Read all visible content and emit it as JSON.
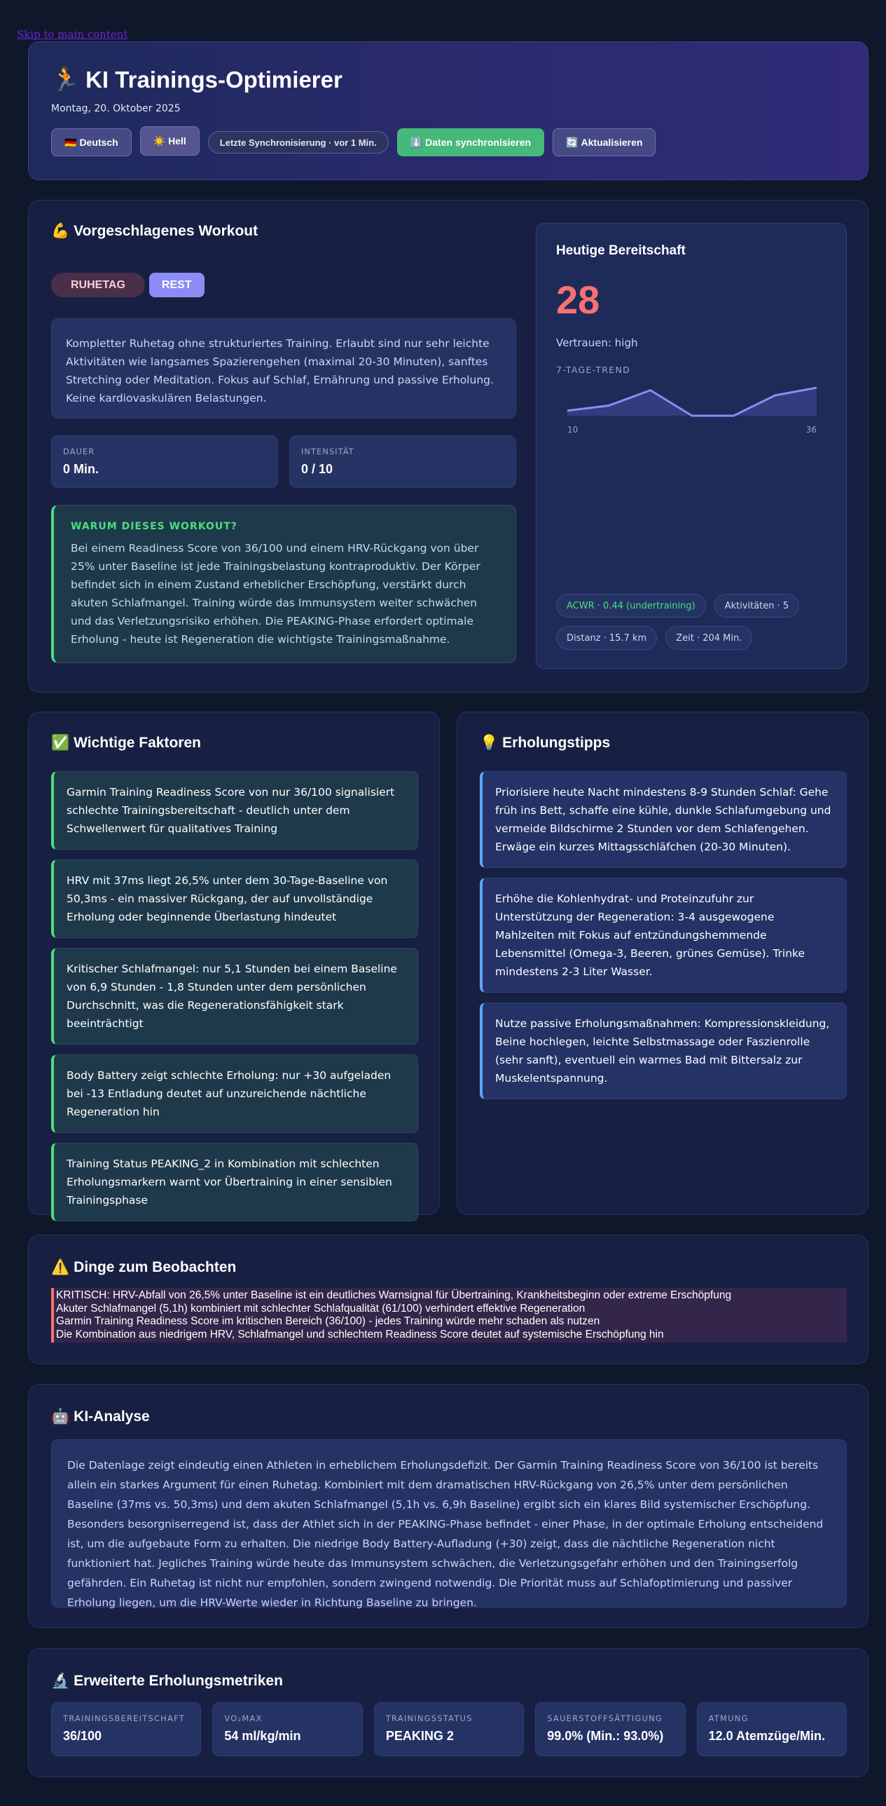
{
  "skip_link": "Skip to main content",
  "header": {
    "icon": "runner-icon",
    "title": "KI Trainings-Optimierer",
    "date": "Montag, 20. Oktober 2025",
    "language_label": "Deutsch",
    "theme_label": "Hell",
    "sync_status": "Letzte Synchronisierung · vor 1 Min.",
    "sync_button": "Daten synchronisieren",
    "refresh_button": "Aktualisieren"
  },
  "workout": {
    "title": "Vorgeschlagenes Workout",
    "tag_de": "RUHETAG",
    "tag_en": "REST",
    "description": "Kompletter Ruhetag ohne strukturiertes Training. Erlaubt sind nur sehr leichte Aktivitäten wie langsames Spazierengehen (maximal 20-30 Minuten), sanftes Stretching oder Meditation. Fokus auf Schlaf, Ernährung und passive Erholung. Keine kardiovaskulären Belastungen.",
    "duration_label": "DAUER",
    "duration_value": "0 Min.",
    "intensity_label": "INTENSITÄT",
    "intensity_value": "0 / 10",
    "why_title": "WARUM DIESES WORKOUT?",
    "why_text": "Bei einem Readiness Score von 36/100 und einem HRV-Rückgang von über 25% unter Baseline ist jede Trainingsbelastung kontraproduktiv. Der Körper befindet sich in einem Zustand erheblicher Erschöpfung, verstärkt durch akuten Schlafmangel. Training würde das Immunsystem weiter schwächen und das Verletzungsrisiko erhöhen. Die PEAKING-Phase erfordert optimale Erholung - heute ist Regeneration die wichtigste Trainingsmaßnahme."
  },
  "readiness": {
    "title": "Heutige Bereitschaft",
    "score": "28",
    "confidence": "Vertrauen: high",
    "trend_label": "7-TAGE-TREND",
    "trend_start": "10",
    "trend_end": "36",
    "trend_values": [
      10,
      12,
      18,
      8,
      8,
      16,
      19
    ],
    "chips": {
      "acwr": "ACWR · 0.44 (undertraining)",
      "activities": "Aktivitäten · 5",
      "distance": "Distanz · 15.7 km",
      "time": "Zeit · 204 Min."
    },
    "colors": {
      "score": "#f87171",
      "trend_line": "#8b8cf6"
    }
  },
  "factors": {
    "title": "Wichtige Faktoren",
    "items": [
      "Garmin Training Readiness Score von nur 36/100 signalisiert schlechte Trainingsbereitschaft - deutlich unter dem Schwellenwert für qualitatives Training",
      "HRV mit 37ms liegt 26,5% unter dem 30-Tage-Baseline von 50,3ms - ein massiver Rückgang, der auf unvollständige Erholung oder beginnende Überlastung hindeutet",
      "Kritischer Schlafmangel: nur 5,1 Stunden bei einem Baseline von 6,9 Stunden - 1,8 Stunden unter dem persönlichen Durchschnitt, was die Regenerationsfähigkeit stark beeinträchtigt",
      "Body Battery zeigt schlechte Erholung: nur +30 aufgeladen bei -13 Entladung deutet auf unzureichende nächtliche Regeneration hin",
      "Training Status PEAKING_2 in Kombination mit schlechten Erholungsmarkern warnt vor Übertraining in einer sensiblen Trainingsphase"
    ]
  },
  "tips": {
    "title": "Erholungstipps",
    "items": [
      "Priorisiere heute Nacht mindestens 8-9 Stunden Schlaf: Gehe früh ins Bett, schaffe eine kühle, dunkle Schlafumgebung und vermeide Bildschirme 2 Stunden vor dem Schlafengehen. Erwäge ein kurzes Mittagsschläfchen (20-30 Minuten).",
      "Erhöhe die Kohlenhydrat- und Proteinzufuhr zur Unterstützung der Regeneration: 3-4 ausgewogene Mahlzeiten mit Fokus auf entzündungshemmende Lebensmittel (Omega-3, Beeren, grünes Gemüse). Trinke mindestens 2-3 Liter Wasser.",
      "Nutze passive Erholungsmaßnahmen: Kompressionskleidung, Beine hochlegen, leichte Selbstmassage oder Faszienrolle (sehr sanft), eventuell ein warmes Bad mit Bittersalz zur Muskelentspannung."
    ]
  },
  "watch": {
    "title": "Dinge zum Beobachten",
    "items": [
      "KRITISCH: HRV-Abfall von 26,5% unter Baseline ist ein deutliches Warnsignal für Übertraining, Krankheitsbeginn oder extreme Erschöpfung",
      "Akuter Schlafmangel (5,1h) kombiniert mit schlechter Schlafqualität (61/100) verhindert effektive Regeneration",
      "Garmin Training Readiness Score im kritischen Bereich (36/100) - jedes Training würde mehr schaden als nutzen",
      "Die Kombination aus niedrigem HRV, Schlafmangel und schlechtem Readiness Score deutet auf systemische Erschöpfung hin"
    ]
  },
  "analysis": {
    "title": "KI-Analyse",
    "text": "Die Datenlage zeigt eindeutig einen Athleten in erheblichem Erholungsdefizit. Der Garmin Training Readiness Score von 36/100 ist bereits allein ein starkes Argument für einen Ruhetag. Kombiniert mit dem dramatischen HRV-Rückgang von 26,5% unter dem persönlichen Baseline (37ms vs. 50,3ms) und dem akuten Schlafmangel (5,1h vs. 6,9h Baseline) ergibt sich ein klares Bild systemischer Erschöpfung. Besonders besorgniserregend ist, dass der Athlet sich in der PEAKING-Phase befindet - einer Phase, in der optimale Erholung entscheidend ist, um die aufgebaute Form zu erhalten. Die niedrige Body Battery-Aufladung (+30) zeigt, dass die nächtliche Regeneration nicht funktioniert hat. Jegliches Training würde heute das Immunsystem schwächen, die Verletzungsgefahr erhöhen und den Trainingserfolg gefährden. Ein Ruhetag ist nicht nur empfohlen, sondern zwingend notwendig. Die Priorität muss auf Schlafoptimierung und passiver Erholung liegen, um die HRV-Werte wieder in Richtung Baseline zu bringen."
  },
  "metrics": {
    "title": "Erweiterte Erholungsmetriken",
    "items": [
      {
        "label": "TRAININGSBEREITSCHAFT",
        "value": "36/100"
      },
      {
        "label": "VO₂MAX",
        "value": "54 ml/kg/min"
      },
      {
        "label": "TRAININGSSTATUS",
        "value": "PEAKING 2"
      },
      {
        "label": "SAUERSTOFFSÄTTIGUNG",
        "value": "99.0% (Min.: 93.0%)"
      },
      {
        "label": "ATMUNG",
        "value": "12.0 Atemzüge/Min."
      }
    ]
  }
}
